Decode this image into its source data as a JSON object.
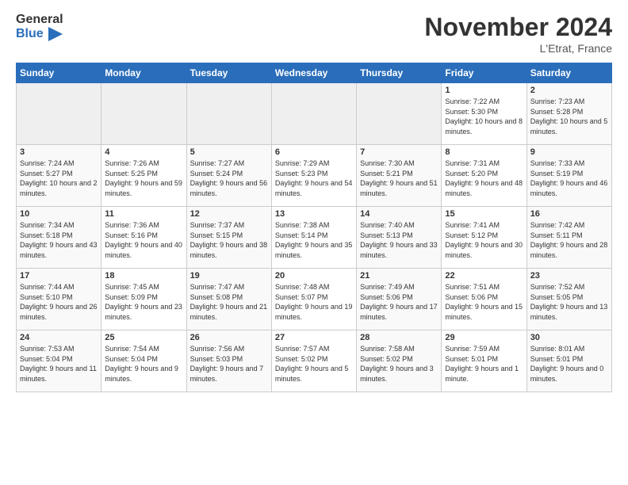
{
  "header": {
    "logo_general": "General",
    "logo_blue": "Blue",
    "month": "November 2024",
    "location": "L'Etrat, France"
  },
  "weekdays": [
    "Sunday",
    "Monday",
    "Tuesday",
    "Wednesday",
    "Thursday",
    "Friday",
    "Saturday"
  ],
  "weeks": [
    [
      {
        "day": "",
        "info": ""
      },
      {
        "day": "",
        "info": ""
      },
      {
        "day": "",
        "info": ""
      },
      {
        "day": "",
        "info": ""
      },
      {
        "day": "",
        "info": ""
      },
      {
        "day": "1",
        "info": "Sunrise: 7:22 AM\nSunset: 5:30 PM\nDaylight: 10 hours\nand 8 minutes."
      },
      {
        "day": "2",
        "info": "Sunrise: 7:23 AM\nSunset: 5:28 PM\nDaylight: 10 hours\nand 5 minutes."
      }
    ],
    [
      {
        "day": "3",
        "info": "Sunrise: 7:24 AM\nSunset: 5:27 PM\nDaylight: 10 hours\nand 2 minutes."
      },
      {
        "day": "4",
        "info": "Sunrise: 7:26 AM\nSunset: 5:25 PM\nDaylight: 9 hours\nand 59 minutes."
      },
      {
        "day": "5",
        "info": "Sunrise: 7:27 AM\nSunset: 5:24 PM\nDaylight: 9 hours\nand 56 minutes."
      },
      {
        "day": "6",
        "info": "Sunrise: 7:29 AM\nSunset: 5:23 PM\nDaylight: 9 hours\nand 54 minutes."
      },
      {
        "day": "7",
        "info": "Sunrise: 7:30 AM\nSunset: 5:21 PM\nDaylight: 9 hours\nand 51 minutes."
      },
      {
        "day": "8",
        "info": "Sunrise: 7:31 AM\nSunset: 5:20 PM\nDaylight: 9 hours\nand 48 minutes."
      },
      {
        "day": "9",
        "info": "Sunrise: 7:33 AM\nSunset: 5:19 PM\nDaylight: 9 hours\nand 46 minutes."
      }
    ],
    [
      {
        "day": "10",
        "info": "Sunrise: 7:34 AM\nSunset: 5:18 PM\nDaylight: 9 hours\nand 43 minutes."
      },
      {
        "day": "11",
        "info": "Sunrise: 7:36 AM\nSunset: 5:16 PM\nDaylight: 9 hours\nand 40 minutes."
      },
      {
        "day": "12",
        "info": "Sunrise: 7:37 AM\nSunset: 5:15 PM\nDaylight: 9 hours\nand 38 minutes."
      },
      {
        "day": "13",
        "info": "Sunrise: 7:38 AM\nSunset: 5:14 PM\nDaylight: 9 hours\nand 35 minutes."
      },
      {
        "day": "14",
        "info": "Sunrise: 7:40 AM\nSunset: 5:13 PM\nDaylight: 9 hours\nand 33 minutes."
      },
      {
        "day": "15",
        "info": "Sunrise: 7:41 AM\nSunset: 5:12 PM\nDaylight: 9 hours\nand 30 minutes."
      },
      {
        "day": "16",
        "info": "Sunrise: 7:42 AM\nSunset: 5:11 PM\nDaylight: 9 hours\nand 28 minutes."
      }
    ],
    [
      {
        "day": "17",
        "info": "Sunrise: 7:44 AM\nSunset: 5:10 PM\nDaylight: 9 hours\nand 26 minutes."
      },
      {
        "day": "18",
        "info": "Sunrise: 7:45 AM\nSunset: 5:09 PM\nDaylight: 9 hours\nand 23 minutes."
      },
      {
        "day": "19",
        "info": "Sunrise: 7:47 AM\nSunset: 5:08 PM\nDaylight: 9 hours\nand 21 minutes."
      },
      {
        "day": "20",
        "info": "Sunrise: 7:48 AM\nSunset: 5:07 PM\nDaylight: 9 hours\nand 19 minutes."
      },
      {
        "day": "21",
        "info": "Sunrise: 7:49 AM\nSunset: 5:06 PM\nDaylight: 9 hours\nand 17 minutes."
      },
      {
        "day": "22",
        "info": "Sunrise: 7:51 AM\nSunset: 5:06 PM\nDaylight: 9 hours\nand 15 minutes."
      },
      {
        "day": "23",
        "info": "Sunrise: 7:52 AM\nSunset: 5:05 PM\nDaylight: 9 hours\nand 13 minutes."
      }
    ],
    [
      {
        "day": "24",
        "info": "Sunrise: 7:53 AM\nSunset: 5:04 PM\nDaylight: 9 hours\nand 11 minutes."
      },
      {
        "day": "25",
        "info": "Sunrise: 7:54 AM\nSunset: 5:04 PM\nDaylight: 9 hours\nand 9 minutes."
      },
      {
        "day": "26",
        "info": "Sunrise: 7:56 AM\nSunset: 5:03 PM\nDaylight: 9 hours\nand 7 minutes."
      },
      {
        "day": "27",
        "info": "Sunrise: 7:57 AM\nSunset: 5:02 PM\nDaylight: 9 hours\nand 5 minutes."
      },
      {
        "day": "28",
        "info": "Sunrise: 7:58 AM\nSunset: 5:02 PM\nDaylight: 9 hours\nand 3 minutes."
      },
      {
        "day": "29",
        "info": "Sunrise: 7:59 AM\nSunset: 5:01 PM\nDaylight: 9 hours\nand 1 minute."
      },
      {
        "day": "30",
        "info": "Sunrise: 8:01 AM\nSunset: 5:01 PM\nDaylight: 9 hours\nand 0 minutes."
      }
    ]
  ]
}
